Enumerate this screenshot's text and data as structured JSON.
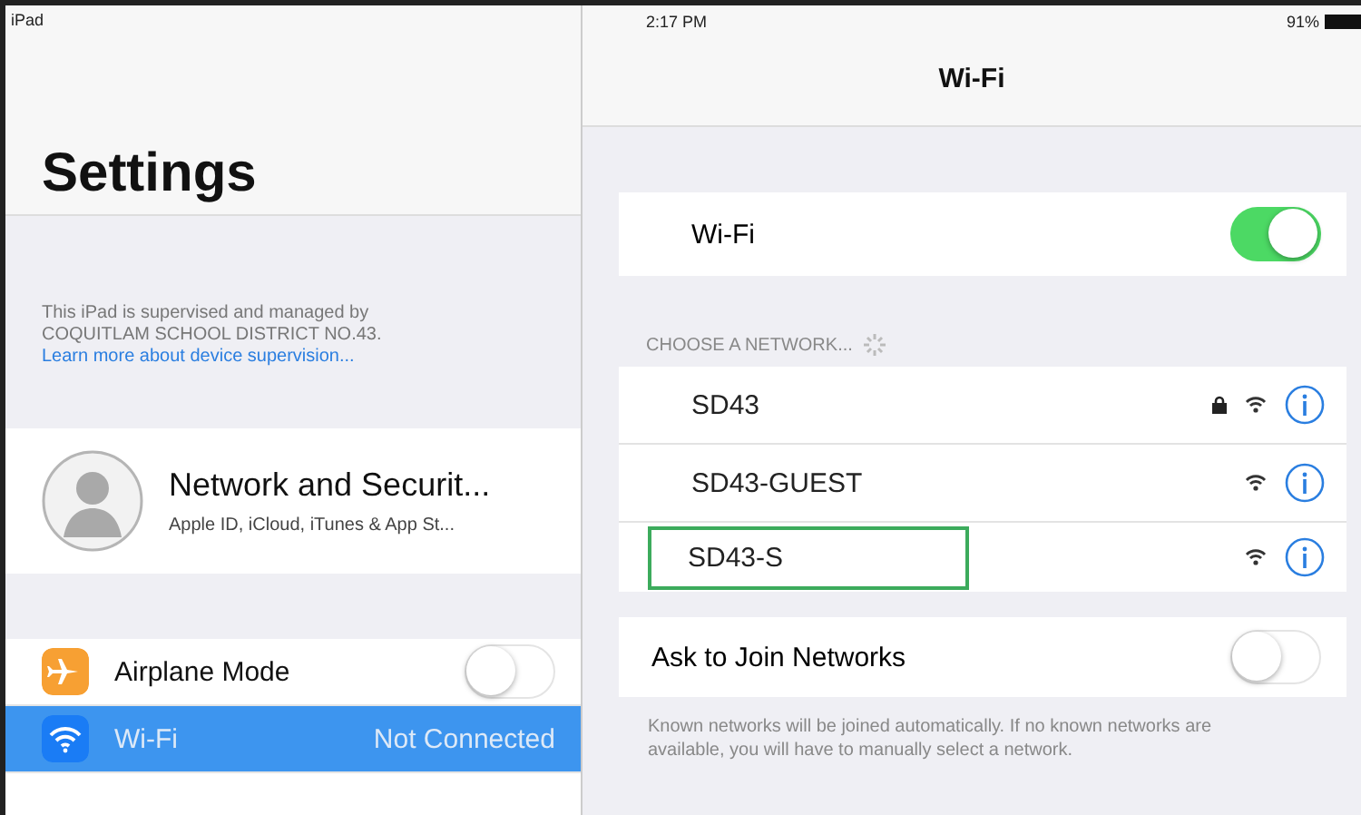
{
  "left_status": {
    "device": "iPad"
  },
  "sidebar": {
    "title": "Settings",
    "supervision_text": "This iPad is supervised and managed by COQUITLAM SCHOOL DISTRICT NO.43.",
    "supervision_link": "Learn more about device supervision...",
    "profile": {
      "name": "Network and Securit...",
      "subtitle": "Apple ID, iCloud, iTunes & App St..."
    },
    "items": [
      {
        "kind": "airplane",
        "label": "Airplane Mode",
        "on": false,
        "selected": false
      },
      {
        "kind": "wifi",
        "label": "Wi-Fi",
        "value": "Not Connected",
        "selected": true
      }
    ]
  },
  "right_status": {
    "time": "2:17 PM",
    "battery": "91%"
  },
  "detail": {
    "title": "Wi-Fi",
    "wifi_toggle": {
      "label": "Wi-Fi",
      "on": true
    },
    "section_header": "CHOOSE A NETWORK...",
    "networks": [
      {
        "name": "SD43",
        "locked": true,
        "highlighted": false
      },
      {
        "name": "SD43-GUEST",
        "locked": false,
        "highlighted": false
      },
      {
        "name": "SD43-S",
        "locked": false,
        "highlighted": true
      }
    ],
    "ask_toggle": {
      "label": "Ask to Join Networks",
      "on": false
    },
    "footer": "Known networks will be joined automatically. If no known networks are available, you will have to manually select a network."
  }
}
